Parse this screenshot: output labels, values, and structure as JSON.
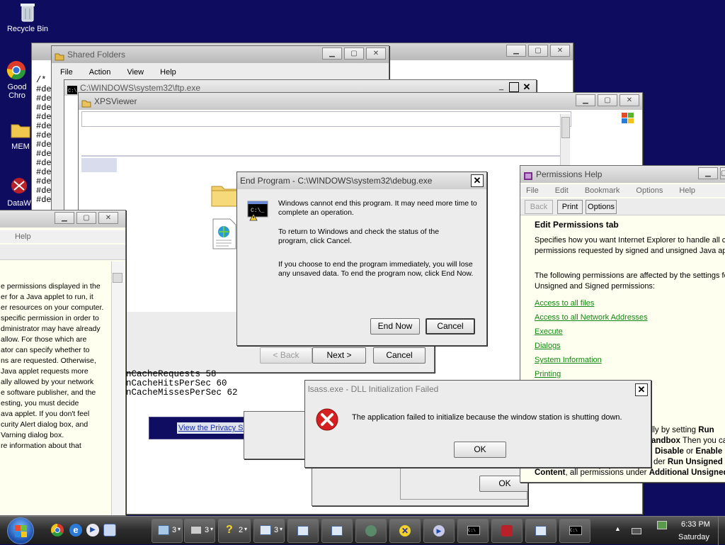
{
  "desktop": {
    "icons": [
      {
        "label": "Recycle Bin"
      },
      {
        "label": "Good Chro"
      },
      {
        "label": "MEM"
      },
      {
        "label": "DataW"
      }
    ]
  },
  "window_back_editor": {
    "lines": [
      "/*",
      "",
      "",
      "#de",
      "#de",
      "#de",
      "#de",
      "#de",
      "#de",
      "#de",
      "#de",
      "#de",
      "#de",
      "#de",
      "#de",
      "#de"
    ]
  },
  "window_shared": {
    "title": "Shared Folders",
    "menu": [
      "File",
      "Action",
      "View",
      "Help"
    ]
  },
  "window_ftp": {
    "title": "C:\\WINDOWS\\system32\\ftp.exe"
  },
  "window_xps": {
    "title": "XPSViewer"
  },
  "window_left_help": {
    "menu": [
      "Help"
    ],
    "text": [
      "e permissions displayed in the",
      "er for a Java applet to run, it",
      "er resources on your computer.",
      " specific permission in order to",
      "dministrator may have already",
      "allow. For those which are",
      "ator can specify whether to",
      "ns are requested. Otherwise,",
      " Java applet requests more",
      "ally allowed by your network",
      "",
      "e software publisher, and the",
      "esting, you must decide",
      "ava applet. If you don't feel",
      "curity Alert dialog box, and",
      "Varning dialog box.",
      "",
      "re information about that"
    ]
  },
  "wizard": {
    "back_label": "< Back",
    "next_label": "Next >",
    "cancel_label": "Cancel"
  },
  "perf_counters": {
    "lines": [
      "nCacheRequests 58",
      "nCacheHitsPerSec 60",
      "nCacheMissesPerSec 62"
    ]
  },
  "privacy_link": "View the Privacy Statement onli",
  "end_program": {
    "title": "End Program - C:\\WINDOWS\\system32\\debug.exe",
    "para1": "Windows cannot end this program. It may need more time to complete an operation.",
    "para2": "To return to Windows and check the status of the program, click Cancel.",
    "para3": "If you choose to end the program immediately, you will lose any unsaved data. To end the program now, click End Now.",
    "end_now_label": "End Now",
    "cancel_label": "Cancel"
  },
  "perm_help": {
    "title": "Permissions Help",
    "menu": [
      "File",
      "Edit",
      "Bookmark",
      "Options",
      "Help"
    ],
    "toolbar": [
      "Back",
      "Print",
      "Options"
    ],
    "heading": "Edit Permissions tab",
    "intro": "Specifies how you want Internet Explorer to handle all co and permissions requested by signed and unsigned Java applets.",
    "intro2": "The following permissions are affected by the settings for Unsigned and Signed permissions:",
    "links": [
      "Access to all files",
      "Access to all Network Addresses",
      "Execute",
      "Dialogs",
      "System Information",
      "Printing"
    ],
    "tail": [
      {
        "plain": "ually by setting ",
        "bold": "Run"
      },
      {
        "plain": "",
        "bold": "andbox",
        "plain2": " Then you ca"
      },
      {
        "plain": "",
        "bold": "Disable",
        "plain2": " or ",
        "bold2": "Enable"
      },
      {
        "plain": "der ",
        "bold": "Run Unsigned"
      },
      {
        "plain": "",
        "bold": "Content",
        "plain2": ", all permissions under ",
        "bold2": "Additional Unsigned"
      }
    ]
  },
  "under_ok_label": "OK",
  "lsass": {
    "title": "lsass.exe - DLL Initialization Failed",
    "message": "The application failed to initialize because the window station is shutting down.",
    "ok_label": "OK"
  },
  "taskbar": {
    "groups": [
      {
        "count": "3"
      },
      {
        "count": "3"
      },
      {
        "count": "2"
      },
      {
        "count": "3"
      }
    ],
    "time": "6:33 PM",
    "day": "Saturday"
  },
  "colors": {
    "desktop": "#0e0c5e",
    "link": "#118811",
    "error_red": "#d42020"
  }
}
